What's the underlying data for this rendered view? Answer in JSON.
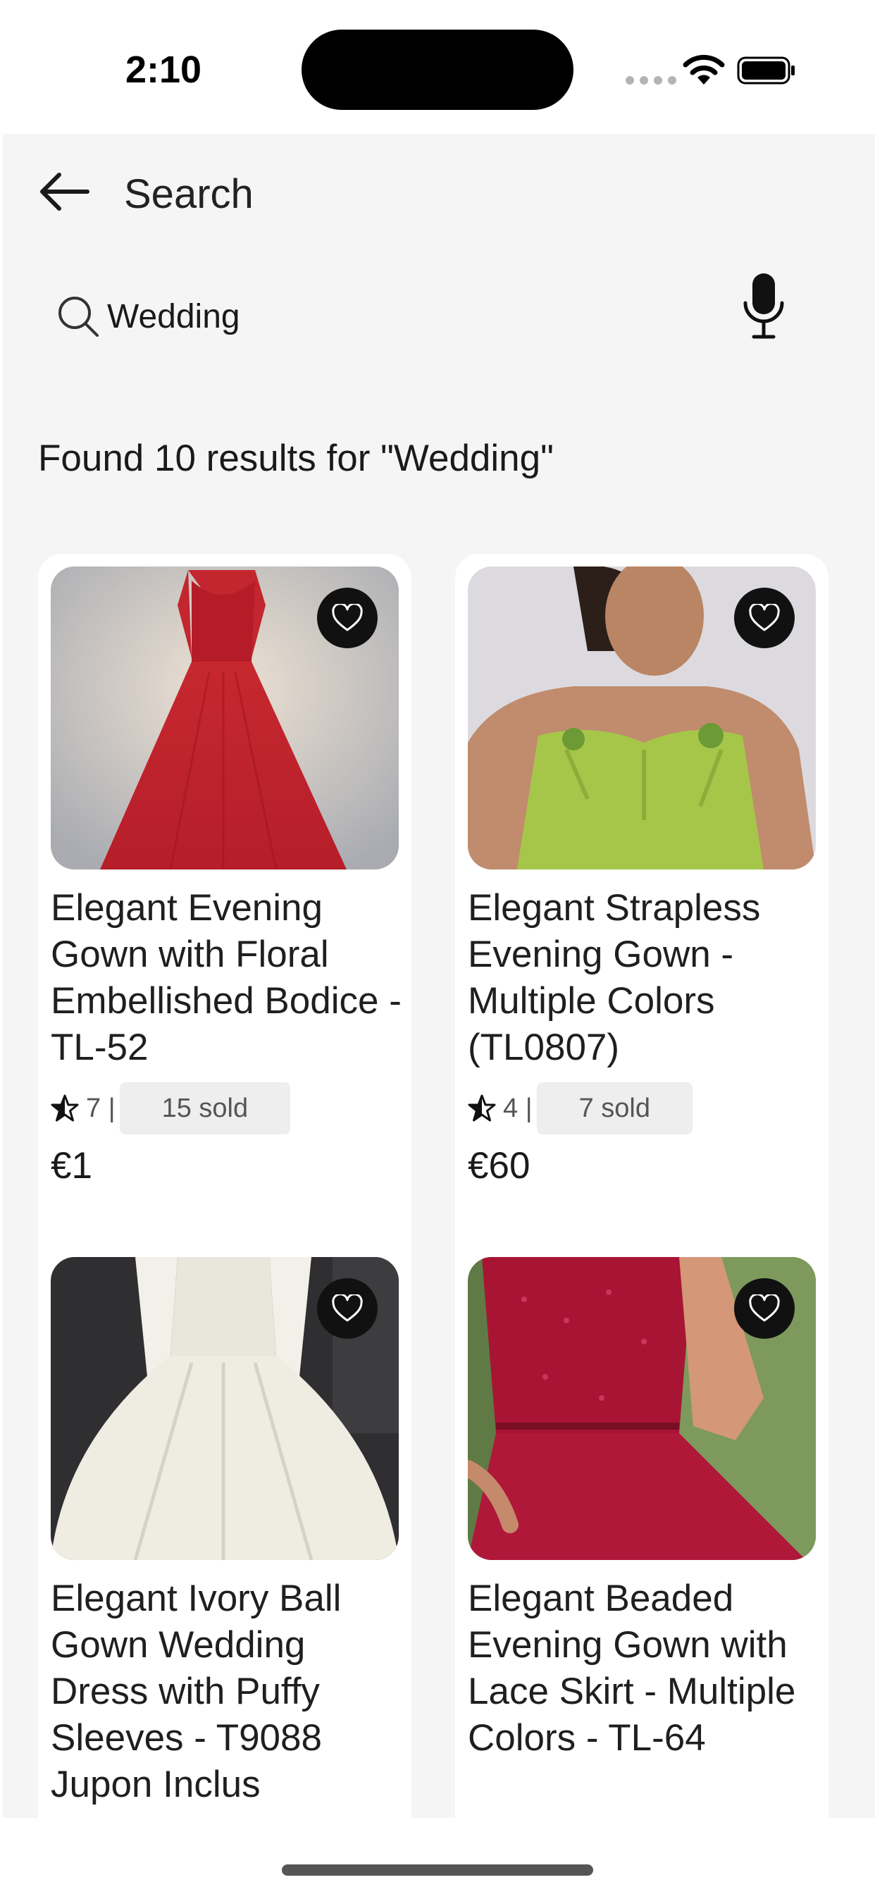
{
  "status_bar": {
    "time": "2:10"
  },
  "header": {
    "title": "Search"
  },
  "search": {
    "value": "Wedding"
  },
  "results_text": "Found 10 results for \"Wedding\"",
  "products": [
    {
      "title": "Elegant Evening Gown with Floral Embellished Bodice - TL-52",
      "rating": "7 |",
      "sold": "15 sold",
      "price": "€1",
      "image_colors": [
        "#b8b9bd",
        "#c3262e"
      ]
    },
    {
      "title": "Elegant Strapless Evening Gown - Multiple Colors (TL0807)",
      "rating": "4 |",
      "sold": "7 sold",
      "price": "€60",
      "image_colors": [
        "#dcdadf",
        "#a6c64a"
      ]
    },
    {
      "title": "Elegant Ivory Ball Gown Wedding Dress with Puffy Sleeves - T9088 Jupon Inclus",
      "image_colors": [
        "#2f2f31",
        "#efece2"
      ]
    },
    {
      "title": "Elegant Beaded Evening Gown with Lace Skirt - Multiple Colors - TL-64",
      "image_colors": [
        "#5f7a45",
        "#b0183a"
      ]
    }
  ]
}
